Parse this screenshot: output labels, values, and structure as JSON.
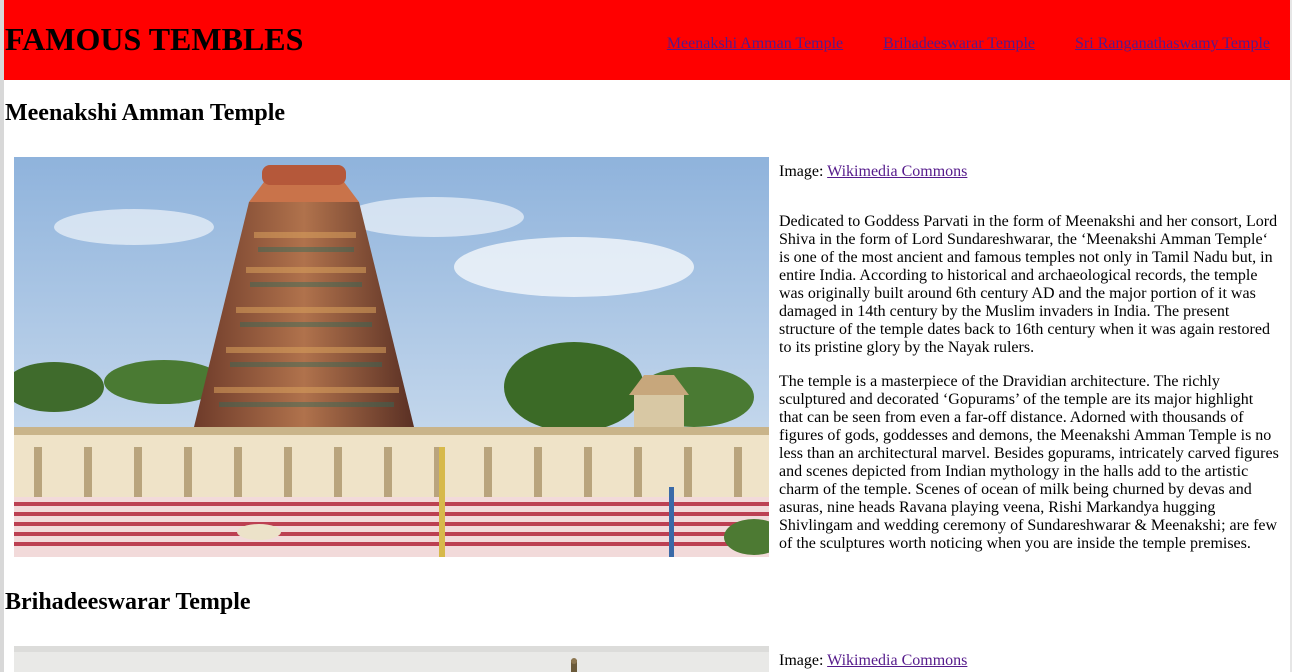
{
  "header": {
    "title": "FAMOUS TEMBLES",
    "nav": [
      {
        "label": "Meenakshi Amman Temple"
      },
      {
        "label": "Brihadeeswarar Temple"
      },
      {
        "label": "Sri Ranganathaswamy Temple"
      }
    ],
    "colors": {
      "background": "#ff0000",
      "link": "#551a8b"
    }
  },
  "sections": [
    {
      "title": "Meenakshi Amman Temple",
      "image": "temple-photo",
      "credit_prefix": "Image: ",
      "credit_link": "Wikimedia Commons",
      "paragraphs": [
        "Dedicated to Goddess Parvati in the form of Meenakshi and her consort, Lord Shiva in the form of Lord Sundareshwarar, the ‘Meenakshi Amman Temple‘ is one of the most ancient and famous temples not only in Tamil Nadu but, in entire India. According to historical and archaeological records, the temple was originally built around 6th century AD and the major portion of it was damaged in 14th century by the Muslim invaders in India. The present structure of the temple dates back to 16th century when it was again restored to its pristine glory by the Nayak rulers.",
        "The temple is a masterpiece of the Dravidian architecture. The richly sculptured and decorated ‘Gopurams’ of the temple are its major highlight that can be seen from even a far-off distance. Adorned with thousands of figures of gods, goddesses and demons, the Meenakshi Amman Temple is no less than an architectural marvel. Besides gopurams, intricately carved figures and scenes depicted from Indian mythology in the halls add to the artistic charm of the temple. Scenes of ocean of milk being churned by devas and asuras, nine heads Ravana playing veena, Rishi Markandya hugging Shivlingam and wedding ceremony of Sundareshwarar & Meenakshi; are few of the sculptures worth noticing when you are inside the temple premises."
      ]
    },
    {
      "title": "Brihadeeswarar Temple",
      "image": "temple-photo",
      "credit_prefix": "Image: ",
      "credit_link": "Wikimedia Commons"
    }
  ]
}
